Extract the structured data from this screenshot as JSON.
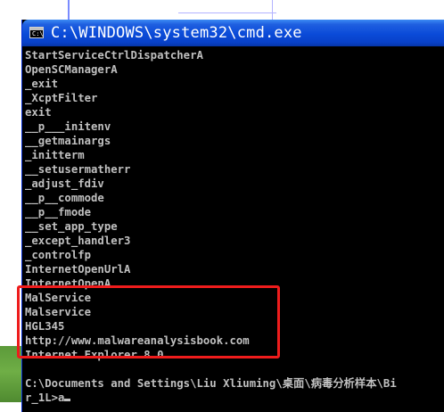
{
  "window": {
    "title": "C:\\WINDOWS\\system32\\cmd.exe",
    "icon": "cmd-icon",
    "icon_glyph": "C:\\"
  },
  "console": {
    "output_lines": [
      "StartServiceCtrlDispatcherA",
      "OpenSCManagerA",
      "_exit",
      "_XcptFilter",
      "exit",
      "__p___initenv",
      "__getmainargs",
      "_initterm",
      "__setusermatherr",
      "_adjust_fdiv",
      "__p__commode",
      "__p__fmode",
      "__set_app_type",
      "_except_handler3",
      "_controlfp",
      "InternetOpenUrlA",
      "InternetOpenA",
      "MalService",
      "Malservice",
      "HGL345",
      "http://www.malwareanalysisbook.com",
      "Internet Explorer 8.0"
    ],
    "prompt_line_1": "C:\\Documents and Settings\\Liu Xliuming\\桌面\\病毒分析样本\\Bi",
    "prompt_line_2": "r_1L>a"
  },
  "annotation": {
    "color": "#ee1c1c"
  },
  "colors": {
    "console_bg": "#000000",
    "console_text": "#c0c0c0",
    "titlebar": "#0a4ad8"
  }
}
